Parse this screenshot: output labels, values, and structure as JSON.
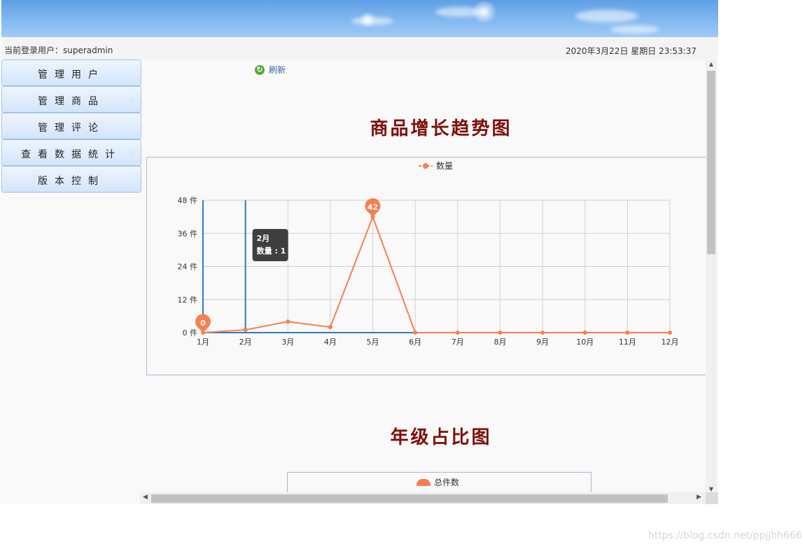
{
  "header": {
    "user_label": "当前登录用户：superadmin",
    "datetime": "2020年3月22日 星期日 23:53:37"
  },
  "sidebar": {
    "items": [
      {
        "label": "管理用户",
        "has_arrow": false
      },
      {
        "label": "管理商品",
        "has_arrow": true
      },
      {
        "label": "管理评论",
        "has_arrow": false
      },
      {
        "label": "查看数据统计",
        "has_arrow": true
      },
      {
        "label": "版本控制",
        "has_arrow": false
      }
    ],
    "arrow_glyph": ">"
  },
  "main": {
    "refresh_label": "刷新",
    "growth_title": "商品增长趋势图",
    "grade_title": "年级占比图",
    "pie_legend": "总件数"
  },
  "chart_data": {
    "type": "line",
    "legend": [
      "数量"
    ],
    "categories": [
      "1月",
      "2月",
      "3月",
      "4月",
      "5月",
      "6月",
      "7月",
      "8月",
      "9月",
      "10月",
      "11月",
      "12月"
    ],
    "series": [
      {
        "name": "数量",
        "values": [
          0,
          1,
          4,
          2,
          42,
          0,
          0,
          0,
          0,
          0,
          0,
          0
        ]
      }
    ],
    "y_ticks": [
      "0 件",
      "12 件",
      "24 件",
      "36 件",
      "48 件"
    ],
    "ylim": [
      0,
      48
    ],
    "grid": true,
    "legend_position": "top-center",
    "markers": [
      {
        "label": "0",
        "index": 0
      },
      {
        "label": "42",
        "index": 4
      }
    ],
    "tooltip": {
      "index": 1,
      "line1": "2月",
      "line2": "数量 : 1"
    },
    "colors": {
      "series": "#f77f52",
      "axis": "#2f7cc0",
      "grid": "#d0d0d0",
      "tooltip_bg": "#3f3f3f"
    }
  },
  "watermark": "https://blog.csdn.net/ppjjhh666"
}
